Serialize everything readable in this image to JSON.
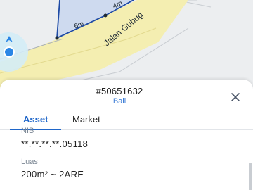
{
  "map": {
    "dimension_labels": [
      "6m",
      "4m"
    ],
    "road_name": "Jalan Gubug",
    "colors": {
      "background": "#eceef0",
      "road_band": "#f4eeb1",
      "parcel_fill": "#c9d6ef",
      "parcel_stroke": "#1f4ba5",
      "location_accent": "#2a86e6",
      "location_halo": "#d4ecf6"
    }
  },
  "sheet": {
    "parcel_id": "#50651632",
    "region": "Bali",
    "close_icon": "close-icon",
    "tabs": [
      {
        "label": "Asset",
        "active": true
      },
      {
        "label": "Market",
        "active": false
      }
    ],
    "fields": [
      {
        "label": "NIB",
        "value": "**.**.**.**.05118"
      },
      {
        "label": "Luas",
        "value": "200m² ~ 2ARE"
      }
    ]
  }
}
